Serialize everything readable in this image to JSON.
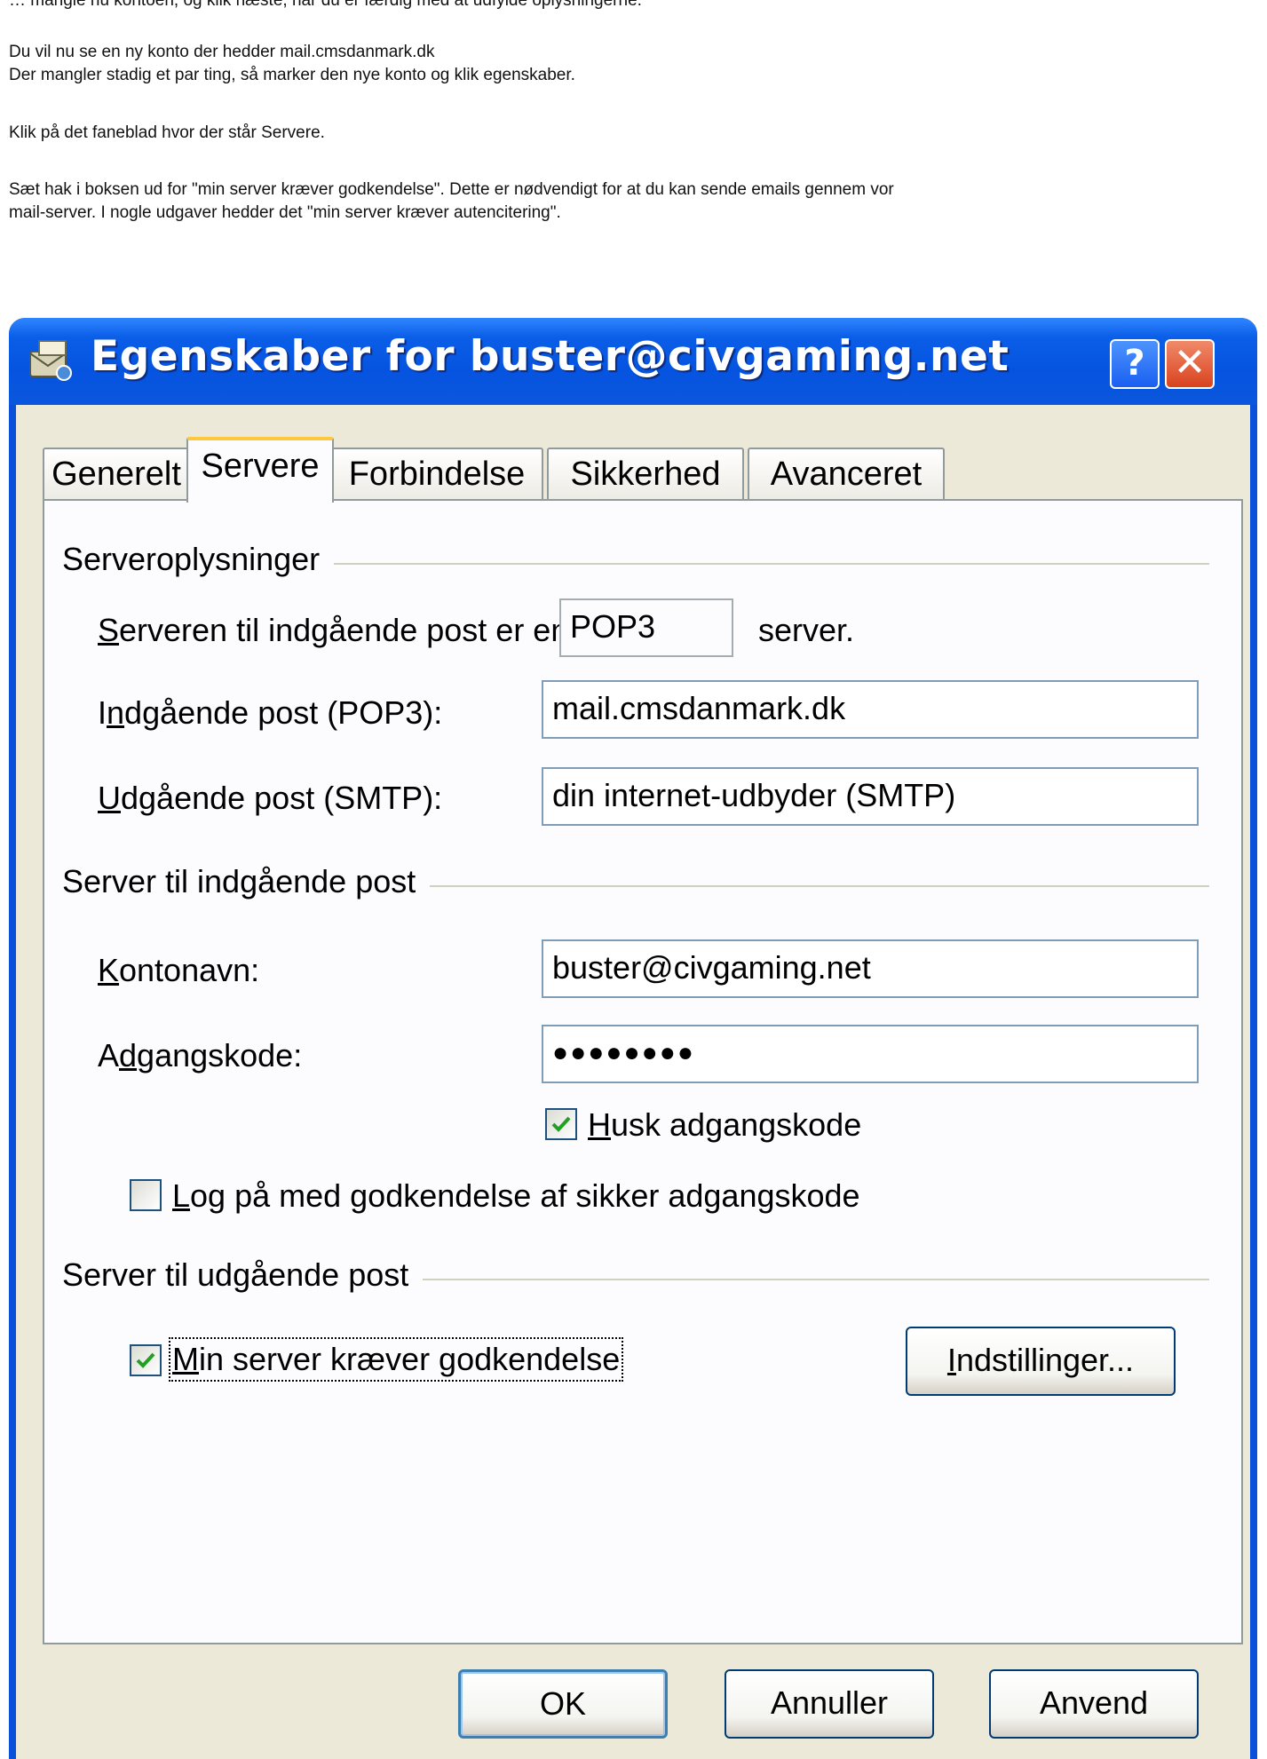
{
  "instructions": {
    "line0": "… mangle nu kontoen, og klik næste, når du er færdig med at udfylde oplysningerne.",
    "line1": "Du vil nu se en ny konto der hedder mail.cmsdanmark.dk",
    "line2": "Der mangler stadig et par ting, så marker den nye konto og klik egenskaber.",
    "line3": "Klik på det faneblad hvor der står Servere.",
    "line4": "Sæt hak i boksen ud for \"min server kræver godkendelse\". Dette er nødvendigt for at du kan sende emails gennem vor",
    "line5": "mail-server. I nogle udgaver hedder det \"min server kræver autencitering\"."
  },
  "dialog": {
    "title": "Egenskaber for buster@civgaming.net",
    "help_label": "?",
    "close_label": "✕",
    "tabs": [
      {
        "label": "Generelt"
      },
      {
        "label": "Servere"
      },
      {
        "label": "Forbindelse"
      },
      {
        "label": "Sikkerhed"
      },
      {
        "label": "Avanceret"
      }
    ],
    "active_tab": "Servere",
    "server_info": {
      "group_label": "Serveroplysninger",
      "incoming_type_prefix_accel": "S",
      "incoming_type_prefix_rest": "erveren til indgående post er en",
      "incoming_type_value": "POP3",
      "incoming_type_suffix": "server.",
      "incoming_label_pre": "I",
      "incoming_label_accel": "n",
      "incoming_label_rest": "dgående post (POP3):",
      "incoming_value": "mail.cmsdanmark.dk",
      "outgoing_label_accel": "U",
      "outgoing_label_rest": "dgående post (SMTP):",
      "outgoing_value": "din internet-udbyder (SMTP)"
    },
    "incoming_server": {
      "group_label": "Server til indgående post",
      "account_label_accel": "K",
      "account_label_rest": "ontonavn:",
      "account_value": "buster@civgaming.net",
      "password_label_pre": "A",
      "password_label_accel": "d",
      "password_label_rest": "gangskode:",
      "password_value": "●●●●●●●●",
      "remember_accel": "H",
      "remember_rest": "usk adgangskode",
      "remember_checked": true,
      "spa_accel": "L",
      "spa_rest": "og på med godkendelse af sikker adgangskode",
      "spa_checked": false
    },
    "outgoing_server": {
      "group_label": "Server til udgående post",
      "auth_accel": "M",
      "auth_rest": "in server kræver godkendelse",
      "auth_checked": true,
      "settings_accel": "I",
      "settings_rest": "ndstillinger..."
    },
    "buttons": {
      "ok": "OK",
      "cancel": "Annuller",
      "apply": "Anvend"
    }
  },
  "colors": {
    "titlebar": "#0554e0",
    "client_bg": "#ece9d8",
    "tab_highlight": "#ffc83c",
    "checkmark": "#21a121"
  }
}
